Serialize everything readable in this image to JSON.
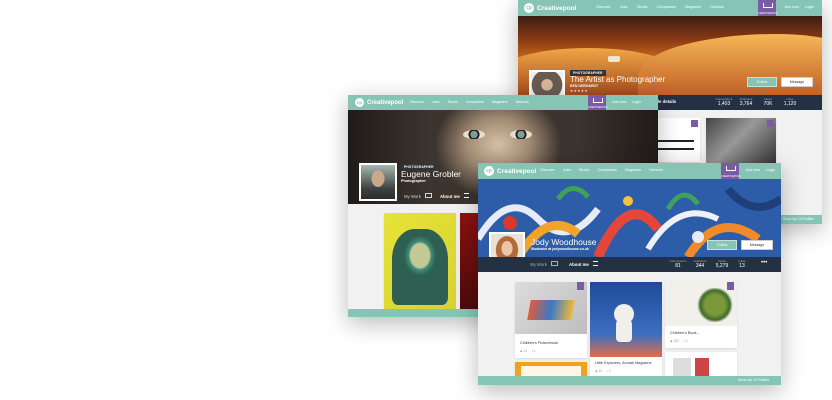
{
  "brand": {
    "name": "Creativepool",
    "logo_letter": "cp",
    "accent": "#86c5b5",
    "purple": "#7a5ca6",
    "navy": "#233143"
  },
  "nav": {
    "links": [
      "Discover",
      "Jobs",
      "Studio",
      "Companies",
      "Magazine",
      "Network"
    ],
    "cp_button": "CREATIVEPOOL",
    "join_label": "Join now",
    "login_label": "Login"
  },
  "back_window": {
    "nav_links": [
      "Discover",
      "Jobs",
      "Studio",
      "Companies",
      "Magazine",
      "Network"
    ],
    "badge": "PHOTOGRAPHER",
    "name": "The Artist as Photographer",
    "role": "KEN GERHARDT",
    "follow_label": "Follow",
    "message_label": "Message",
    "tab_about": "Profile details",
    "stats": [
      {
        "label": "Connections",
        "value": "1,403"
      },
      {
        "label": "Followers",
        "value": "3,764"
      },
      {
        "label": "Views",
        "value": "70K"
      },
      {
        "label": "Likes",
        "value": "1,120"
      }
    ],
    "footer": "Show top 10 Profiles"
  },
  "middle_window": {
    "badge": "PHOTOGRAPHER",
    "name": "Eugene Grobler",
    "role": "Photographer",
    "tab_work": "My Work",
    "tab_about": "About me"
  },
  "front_window": {
    "name": "Jody Woodhouse",
    "role": "Illustrator at jodywoodhouse.co.uk",
    "follow_label": "Follow",
    "message_label": "Message",
    "tab_work": "My Work",
    "tab_about": "About me",
    "stats": [
      {
        "label": "Connections",
        "value": "81"
      },
      {
        "label": "Followers",
        "value": "344"
      },
      {
        "label": "Views",
        "value": "5,279"
      },
      {
        "label": "Likes",
        "value": "13"
      }
    ],
    "more_label": "•••",
    "cards": [
      {
        "title": "Children's Picturebook",
        "views": "11",
        "likes": "1"
      },
      {
        "title": "Little Explorers, Anorak Magazine",
        "views": "10",
        "likes": "1"
      },
      {
        "title": "Children's Book...",
        "views": "220",
        "likes": "1"
      }
    ],
    "footer": "Show top 10 Profiles"
  }
}
